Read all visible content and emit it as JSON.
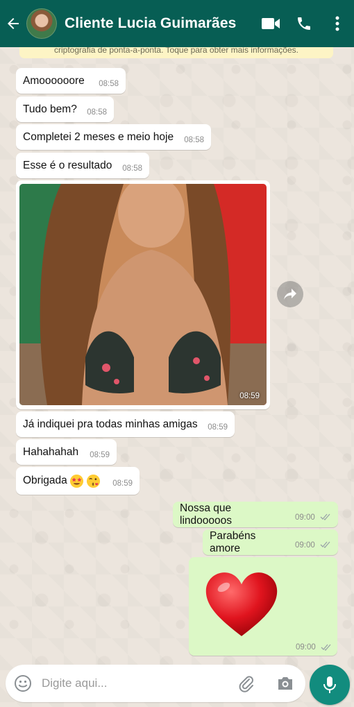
{
  "header": {
    "contact_name": "Cliente Lucia Guimarães",
    "icons": [
      "back-arrow-icon",
      "video-call-icon",
      "phone-icon",
      "more-vert-icon"
    ]
  },
  "banner": {
    "text": "criptografia de ponta-a-ponta. Toque para obter mais informações."
  },
  "messages": [
    {
      "dir": "in",
      "text": "Amoooooore",
      "time": "08:58"
    },
    {
      "dir": "in",
      "text": "Tudo bem?",
      "time": "08:58"
    },
    {
      "dir": "in",
      "text": "Completei 2 meses e meio hoje",
      "time": "08:58"
    },
    {
      "dir": "in",
      "text": "Esse é o resultado",
      "time": "08:58"
    },
    {
      "dir": "in",
      "type": "photo",
      "time": "08:59"
    },
    {
      "dir": "in",
      "text": "Já indiquei pra todas minhas amigas",
      "time": "08:59"
    },
    {
      "dir": "in",
      "text": "Hahahahah",
      "time": "08:59"
    },
    {
      "dir": "in",
      "text": "Obrigada",
      "emojis": [
        "star-struck-emoji",
        "kissing-heart-emoji"
      ],
      "time": "08:59"
    },
    {
      "dir": "out",
      "text": "Nossa que lindooooos",
      "time": "09:00",
      "status": "read"
    },
    {
      "dir": "out",
      "text": "Parabéns amore",
      "time": "09:00",
      "status": "read"
    },
    {
      "dir": "out",
      "type": "sticker",
      "sticker": "red-heart-emoji",
      "time": "09:00",
      "status": "read"
    }
  ],
  "composer": {
    "placeholder": "Digite aqui...",
    "value": "",
    "icons": [
      "emoji-icon",
      "attach-icon",
      "camera-icon",
      "mic-icon"
    ]
  },
  "colors": {
    "header": "#075e54",
    "incoming": "#ffffff",
    "outgoing": "#dcf8c6",
    "mic_button": "#128c7e",
    "read_ticks": "#34b7f1"
  }
}
